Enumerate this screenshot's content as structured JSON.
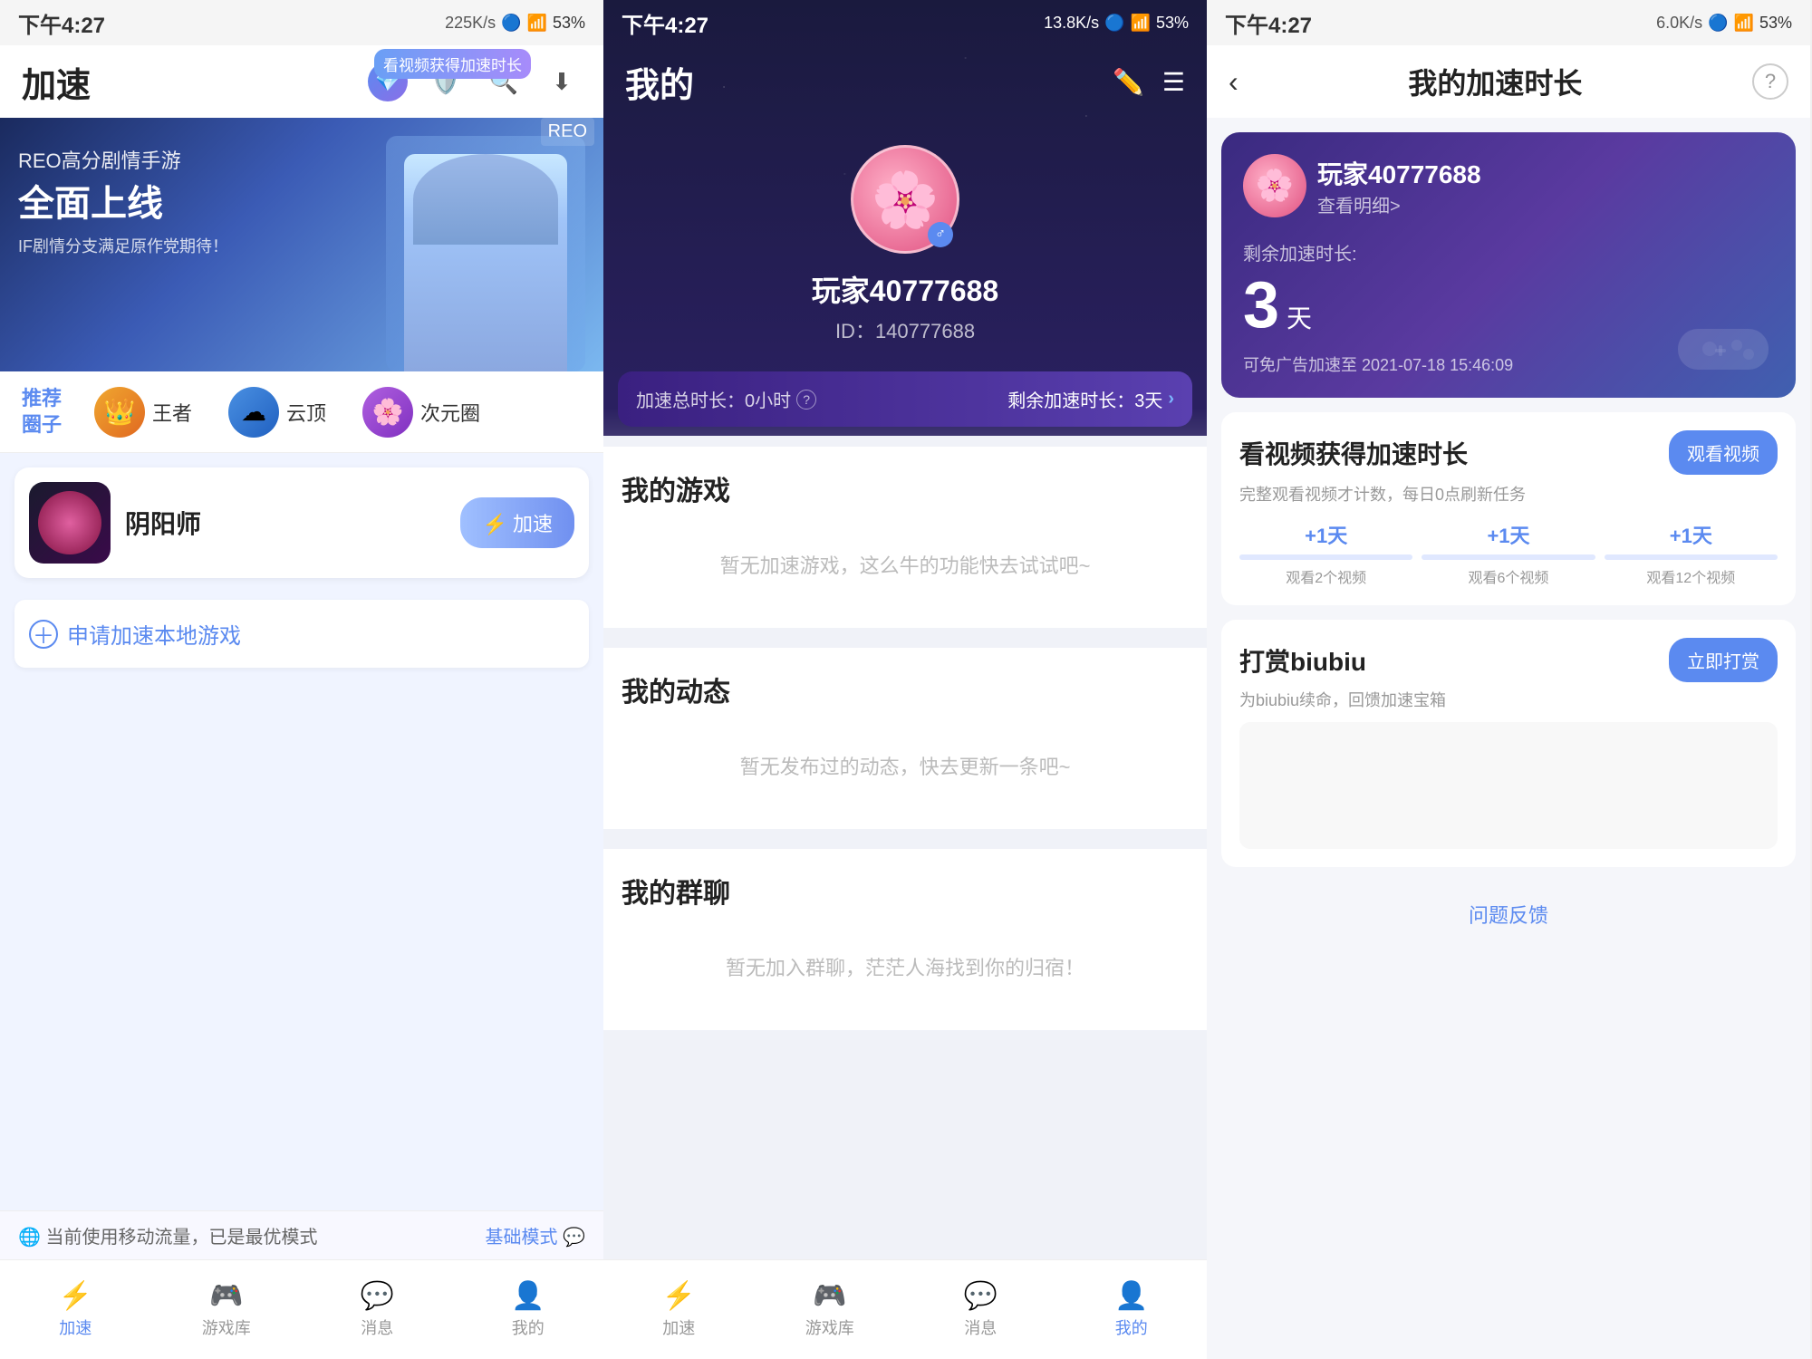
{
  "panel1": {
    "statusBar": {
      "time": "下午4:27",
      "speed": "225K/s",
      "battery": "53%"
    },
    "header": {
      "title": "加速",
      "speedBadge": "看视频获得加速时长"
    },
    "banner": {
      "sub": "REO高分剧情手游",
      "main": "全面上线",
      "desc": "IF剧情分支满足原作党期待！",
      "tag": "REO"
    },
    "recommendTabs": {
      "label": "推荐\n圈子",
      "items": [
        {
          "name": "王者"
        },
        {
          "name": "云顶"
        },
        {
          "name": "次元圈"
        }
      ]
    },
    "gameCard": {
      "name": "阴阳师",
      "btnLabel": "⚡ 加速"
    },
    "applyRow": {
      "label": "申请加速本地游戏"
    },
    "bottomTip": {
      "left": "🌐 当前使用移动流量，已是最优模式",
      "right": "基础模式 💬"
    },
    "bottomNav": [
      {
        "icon": "⚡",
        "label": "加速",
        "active": true
      },
      {
        "icon": "🎮",
        "label": "游戏库",
        "active": false
      },
      {
        "icon": "💬",
        "label": "消息",
        "active": false
      },
      {
        "icon": "👤",
        "label": "我的",
        "active": false
      }
    ]
  },
  "panel2": {
    "statusBar": {
      "time": "下午4:27",
      "speed": "13.8K/s",
      "battery": "53%"
    },
    "header": {
      "title": "我的"
    },
    "profile": {
      "name": "玩家40777688",
      "id": "ID：140777688"
    },
    "speedBar": {
      "totalLabel": "加速总时长：0小时",
      "remainLabel": "剩余加速时长：3天",
      "arrow": ">"
    },
    "sections": [
      {
        "title": "我的游戏",
        "emptyText": "暂无加速游戏，这么牛的功能快去试试吧~"
      },
      {
        "title": "我的动态",
        "emptyText": "暂无发布过的动态，快去更新一条吧~"
      },
      {
        "title": "我的群聊",
        "emptyText": "暂无加入群聊，茫茫人海找到你的归宿！"
      }
    ],
    "bottomNav": [
      {
        "icon": "⚡",
        "label": "加速",
        "active": false
      },
      {
        "icon": "🎮",
        "label": "游戏库",
        "active": false
      },
      {
        "icon": "💬",
        "label": "消息",
        "active": false
      },
      {
        "icon": "👤",
        "label": "我的",
        "active": true
      }
    ]
  },
  "panel3": {
    "statusBar": {
      "time": "下午4:27",
      "speed": "6.0K/s",
      "battery": "53%"
    },
    "header": {
      "back": "‹",
      "title": "我的加速时长",
      "help": "?"
    },
    "userCard": {
      "name": "玩家40777688",
      "detailLink": "查看明细>",
      "remainingLabel": "剩余加速时长:",
      "days": "3",
      "unit": "天",
      "adFreeText": "可免广告加速至 2021-07-18 15:46:09"
    },
    "watchVideoSection": {
      "title": "看视频获得加速时长",
      "btnLabel": "观看视频",
      "desc": "完整观看视频才计数，每日0点刷新任务",
      "tasks": [
        {
          "plus": "+1天",
          "label": "观看2个视频"
        },
        {
          "plus": "+1天",
          "label": "观看6个视频"
        },
        {
          "plus": "+1天",
          "label": "观看12个视频"
        }
      ]
    },
    "rewardSection": {
      "title": "打赏biubiu",
      "btnLabel": "立即打赏",
      "desc": "为biubiu续命，回馈加速宝箱"
    },
    "feedbackLabel": "问题反馈"
  }
}
